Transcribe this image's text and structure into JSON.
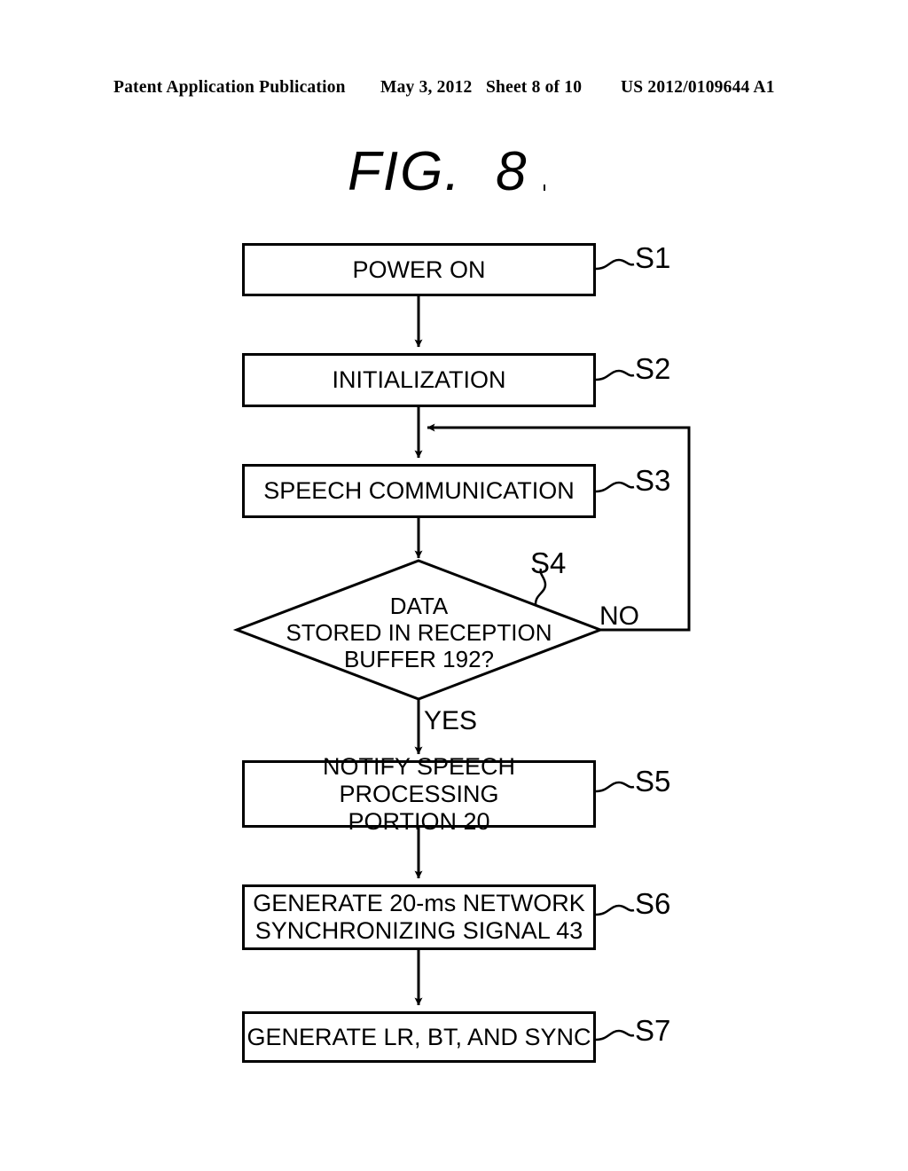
{
  "header": {
    "publication": "Patent Application Publication",
    "date": "May 3, 2012",
    "sheet": "Sheet 8 of 10",
    "number": "US 2012/0109644 A1"
  },
  "figure": {
    "title": "FIG.  8"
  },
  "flowchart": {
    "steps": [
      {
        "id": "S1",
        "label": "S1",
        "text": "POWER ON",
        "shape": "process"
      },
      {
        "id": "S2",
        "label": "S2",
        "text": "INITIALIZATION",
        "shape": "process"
      },
      {
        "id": "S3",
        "label": "S3",
        "text": "SPEECH COMMUNICATION",
        "shape": "process"
      },
      {
        "id": "S4",
        "label": "S4",
        "text": "DATA\nSTORED IN RECEPTION\nBUFFER 192?",
        "shape": "decision"
      },
      {
        "id": "S5",
        "label": "S5",
        "text": "NOTIFY SPEECH PROCESSING\nPORTION 20",
        "shape": "process"
      },
      {
        "id": "S6",
        "label": "S6",
        "text": "GENERATE 20-ms NETWORK\nSYNCHRONIZING SIGNAL 43",
        "shape": "process"
      },
      {
        "id": "S7",
        "label": "S7",
        "text": "GENERATE LR, BT, AND SYNC",
        "shape": "process"
      }
    ],
    "branches": {
      "no": "NO",
      "yes": "YES"
    },
    "colors": {
      "stroke": "#000000",
      "background": "#ffffff"
    }
  }
}
